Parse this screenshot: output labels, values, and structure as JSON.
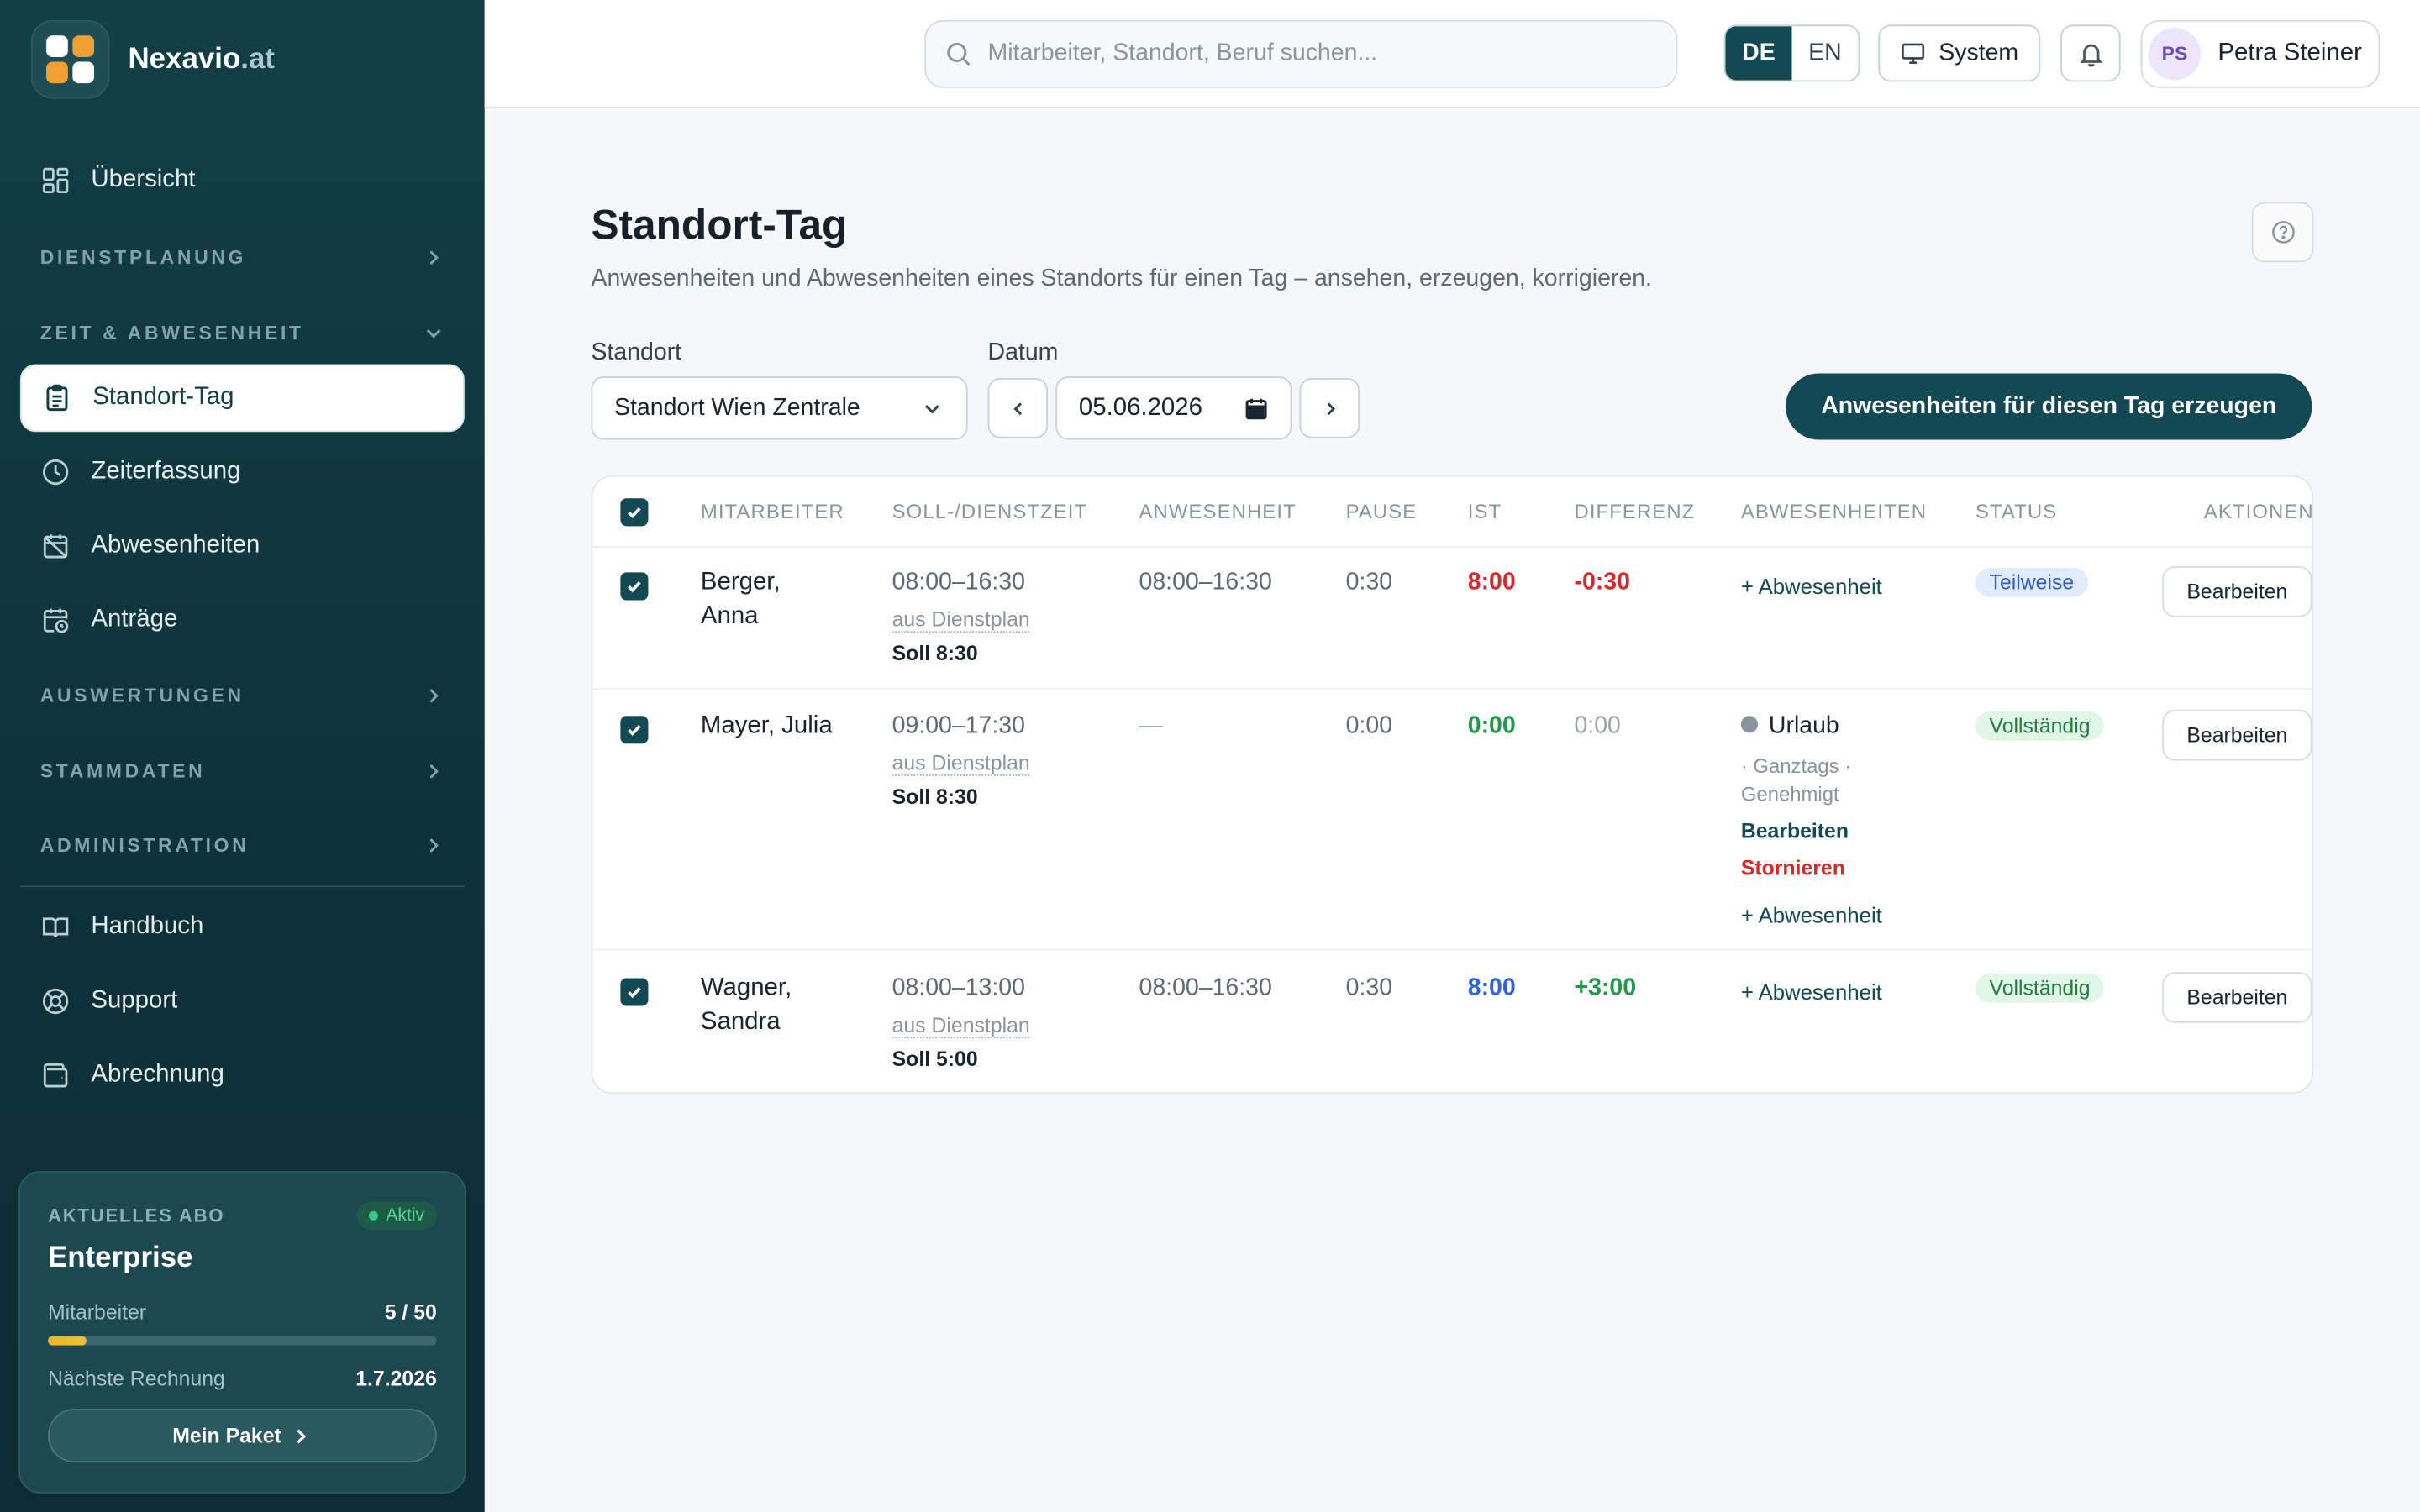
{
  "brand": {
    "name": "Nexavio",
    "tld": ".at",
    "logo_colors": [
      "#ffffff",
      "#f0a030",
      "#f0a030",
      "#ffffff"
    ]
  },
  "sidebar": {
    "overview": "Übersicht",
    "sections": {
      "planning": "DIENSTPLANUNG",
      "time": "ZEIT & ABWESENHEIT",
      "reports": "AUSWERTUNGEN",
      "master": "STAMMDATEN",
      "admin": "ADMINISTRATION"
    },
    "time_items": [
      "Standort-Tag",
      "Zeiterfassung",
      "Abwesenheiten",
      "Anträge"
    ],
    "footer_items": [
      "Handbuch",
      "Support",
      "Abrechnung"
    ],
    "plan": {
      "label": "AKTUELLES ABO",
      "status": "Aktiv",
      "name": "Enterprise",
      "employees_label": "Mitarbeiter",
      "employees_value": "5 / 50",
      "employees_fraction": 0.1,
      "next_invoice_label": "Nächste Rechnung",
      "next_invoice_value": "1.7.2026",
      "button": "Mein Paket"
    }
  },
  "header": {
    "search_placeholder": "Mitarbeiter, Standort, Beruf suchen...",
    "lang_de": "DE",
    "lang_en": "EN",
    "theme": "System",
    "user_initials": "PS",
    "user_name": "Petra Steiner"
  },
  "page": {
    "title": "Standort-Tag",
    "subtitle": "Anwesenheiten und Abwesenheiten eines Standorts für einen Tag – ansehen, erzeugen, korrigieren.",
    "location_label": "Standort",
    "location_value": "Standort Wien Zentrale",
    "date_label": "Datum",
    "date_value": "05.06.2026",
    "primary_button": "Anwesenheiten für diesen Tag erzeugen"
  },
  "table": {
    "headers": [
      "MITARBEITER",
      "SOLL-/DIENSTZEIT",
      "ANWESENHEIT",
      "PAUSE",
      "IST",
      "DIFFERENZ",
      "ABWESENHEITEN",
      "STATUS",
      "AKTIONEN"
    ],
    "rows": [
      {
        "name_1": "Berger,",
        "name_2": "Anna",
        "shift": "08:00–16:30",
        "shift_source": "aus Dienstplan",
        "soll": "Soll 8:30",
        "presence": "08:00–16:30",
        "pause": "0:30",
        "ist": "8:00",
        "diff": "-0:30",
        "absence_add": "+ Abwesenheit",
        "status": "Teilweise",
        "action": "Bearbeiten"
      },
      {
        "name_1": "Mayer, Julia",
        "name_2": "",
        "shift": "09:00–17:30",
        "shift_source": "aus Dienstplan",
        "soll": "Soll 8:30",
        "presence": "—",
        "pause": "0:00",
        "ist": "0:00",
        "diff": "0:00",
        "absence_type": "Urlaub",
        "absence_meta_1": "· Ganztags ·",
        "absence_meta_2": "Genehmigt",
        "absence_edit": "Bearbeiten",
        "absence_cancel": "Stornieren",
        "absence_add": "+ Abwesenheit",
        "status": "Vollständig",
        "action": "Bearbeiten"
      },
      {
        "name_1": "Wagner,",
        "name_2": "Sandra",
        "shift": "08:00–13:00",
        "shift_source": "aus Dienstplan",
        "soll": "Soll 5:00",
        "presence": "08:00–16:30",
        "pause": "0:30",
        "ist": "8:00",
        "diff": "+3:00",
        "absence_add": "+ Abwesenheit",
        "status": "Vollständig",
        "action": "Bearbeiten"
      }
    ]
  },
  "colors": {
    "sidebar": "#123e47",
    "accent": "#124952",
    "danger": "#d42a2a",
    "success": "#1f9a4a",
    "info": "#2f62e0"
  }
}
